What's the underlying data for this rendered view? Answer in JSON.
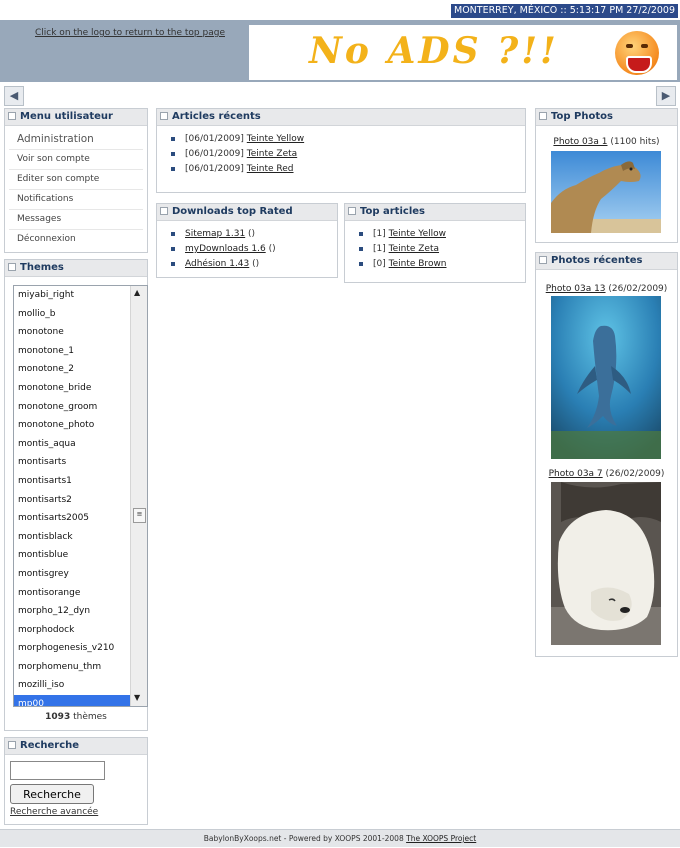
{
  "header": {
    "datetime": "MONTERREY, MÉXICO :: 5:13:17 PM 27/2/2009",
    "logo_hint": "Click on the logo to return to the top page",
    "banner_text": "No ADS ?!!"
  },
  "nav": {
    "left_arrow": "◀",
    "right_arrow": "▶"
  },
  "user_menu": {
    "title": "Menu utilisateur",
    "items": [
      "Administration",
      "Voir son compte",
      "Editer son compte",
      "Notifications",
      "Messages",
      "Déconnexion"
    ]
  },
  "themes": {
    "title": "Themes",
    "items": [
      "miyabi_right",
      "mollio_b",
      "monotone",
      "monotone_1",
      "monotone_2",
      "monotone_bride",
      "monotone_groom",
      "monotone_photo",
      "montis_aqua",
      "montisarts",
      "montisarts1",
      "montisarts2",
      "montisarts2005",
      "montisblack",
      "montisblue",
      "montisgrey",
      "montisorange",
      "morpho_12_dyn",
      "morphodock",
      "morphogenesis_v210",
      "morphomenu_thm",
      "mozilli_iso",
      "mp00"
    ],
    "selected": "mp00",
    "count": "1093",
    "count_suffix": " thèmes"
  },
  "search": {
    "title": "Recherche",
    "button": "Recherche",
    "advanced_link": "Recherche avancée",
    "input_value": ""
  },
  "recent_articles": {
    "title": "Articles récents",
    "items": [
      {
        "date": "[06/01/2009]",
        "link": "Teinte Yellow"
      },
      {
        "date": "[06/01/2009]",
        "link": "Teinte Zeta"
      },
      {
        "date": "[06/01/2009]",
        "link": "Teinte Red"
      }
    ]
  },
  "downloads": {
    "title": "Downloads top Rated",
    "items": [
      {
        "link": "Sitemap 1.31",
        "suffix": " ()"
      },
      {
        "link": "myDownloads 1.6",
        "suffix": " ()"
      },
      {
        "link": "Adhésion 1.43",
        "suffix": " ()"
      }
    ]
  },
  "top_articles": {
    "title": "Top articles",
    "items": [
      {
        "rank": "[1]",
        "link": "Teinte Yellow"
      },
      {
        "rank": "[1]",
        "link": "Teinte Zeta"
      },
      {
        "rank": "[0]",
        "link": "Teinte Brown"
      }
    ]
  },
  "top_photos": {
    "title": "Top Photos",
    "photo_link": "Photo 03a 1",
    "photo_hits": " (1100 hits)"
  },
  "recent_photos": {
    "title": "Photos récentes",
    "photos": [
      {
        "link": "Photo 03a 13",
        "date": " (26/02/2009)"
      },
      {
        "link": "Photo 03a 7",
        "date": " (26/02/2009)"
      }
    ]
  },
  "footer": {
    "text": "BabylonByXoops.net - Powered by XOOPS 2001-2008 ",
    "link": "The XOOPS Project"
  },
  "colors": {
    "header_bg": "#98a8ba",
    "clock_bg": "#2c4a8a",
    "selected": "#3373e8",
    "banner_text": "#f3b21a"
  }
}
